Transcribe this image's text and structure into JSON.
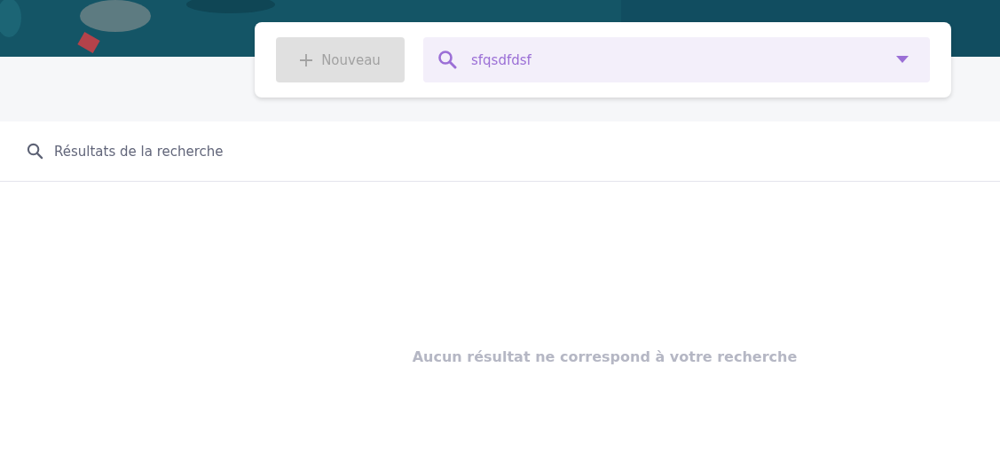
{
  "toolbar": {
    "new_button": {
      "label": "Nouveau",
      "disabled": true
    },
    "search": {
      "value": "sfqsdfdsf"
    }
  },
  "results": {
    "title": "Résultats de la recherche",
    "empty_message": "Aucun résultat ne correspond à votre recherche"
  }
}
